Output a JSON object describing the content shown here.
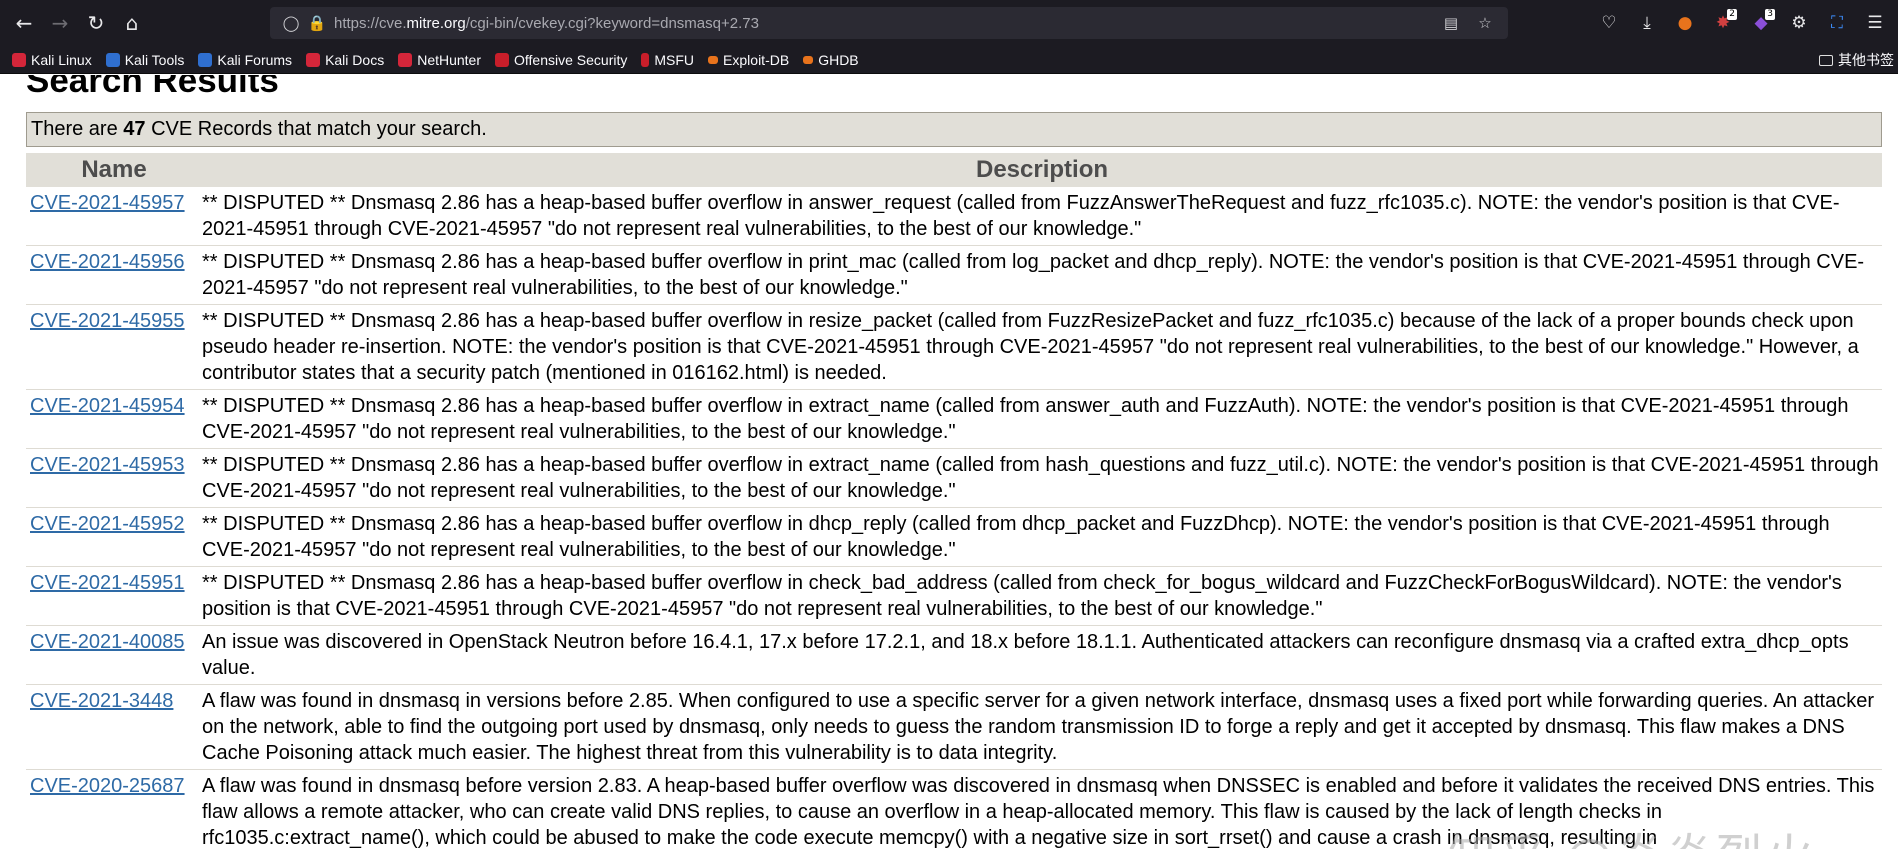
{
  "browser": {
    "url_prefix": "https://cve.",
    "url_domain": "mitre.org",
    "url_path": "/cgi-bin/cvekey.cgi?keyword=dnsmasq+2.73",
    "extension_badges": [
      "2",
      "3"
    ]
  },
  "bookmarks": [
    {
      "label": "Kali Linux",
      "color": "#d4263a"
    },
    {
      "label": "Kali Tools",
      "color": "#2f6fd0"
    },
    {
      "label": "Kali Forums",
      "color": "#2f6fd0"
    },
    {
      "label": "Kali Docs",
      "color": "#d4263a"
    },
    {
      "label": "NetHunter",
      "color": "#d4263a"
    },
    {
      "label": "Offensive Security",
      "color": "#c81e2a"
    },
    {
      "label": "MSFU",
      "color": "#c81e2a"
    },
    {
      "label": "Exploit-DB",
      "color": "#e8731c"
    },
    {
      "label": "GHDB",
      "color": "#e8731c"
    }
  ],
  "bookmarks_other": "其他书签",
  "page": {
    "heading": "Search Results",
    "match_prefix": "There are ",
    "match_count": "47",
    "match_suffix": " CVE Records that match your search.",
    "col_name": "Name",
    "col_description": "Description"
  },
  "results": [
    {
      "id": "CVE-2021-45957",
      "desc": "** DISPUTED ** Dnsmasq 2.86 has a heap-based buffer overflow in answer_request (called from FuzzAnswerTheRequest and fuzz_rfc1035.c). NOTE: the vendor's position is that CVE-2021-45951 through CVE-2021-45957 \"do not represent real vulnerabilities, to the best of our knowledge.\""
    },
    {
      "id": "CVE-2021-45956",
      "desc": "** DISPUTED ** Dnsmasq 2.86 has a heap-based buffer overflow in print_mac (called from log_packet and dhcp_reply). NOTE: the vendor's position is that CVE-2021-45951 through CVE-2021-45957 \"do not represent real vulnerabilities, to the best of our knowledge.\""
    },
    {
      "id": "CVE-2021-45955",
      "desc": "** DISPUTED ** Dnsmasq 2.86 has a heap-based buffer overflow in resize_packet (called from FuzzResizePacket and fuzz_rfc1035.c) because of the lack of a proper bounds check upon pseudo header re-insertion. NOTE: the vendor's position is that CVE-2021-45951 through CVE-2021-45957 \"do not represent real vulnerabilities, to the best of our knowledge.\" However, a contributor states that a security patch (mentioned in 016162.html) is needed."
    },
    {
      "id": "CVE-2021-45954",
      "desc": "** DISPUTED ** Dnsmasq 2.86 has a heap-based buffer overflow in extract_name (called from answer_auth and FuzzAuth). NOTE: the vendor's position is that CVE-2021-45951 through CVE-2021-45957 \"do not represent real vulnerabilities, to the best of our knowledge.\""
    },
    {
      "id": "CVE-2021-45953",
      "desc": "** DISPUTED ** Dnsmasq 2.86 has a heap-based buffer overflow in extract_name (called from hash_questions and fuzz_util.c). NOTE: the vendor's position is that CVE-2021-45951 through CVE-2021-45957 \"do not represent real vulnerabilities, to the best of our knowledge.\""
    },
    {
      "id": "CVE-2021-45952",
      "desc": "** DISPUTED ** Dnsmasq 2.86 has a heap-based buffer overflow in dhcp_reply (called from dhcp_packet and FuzzDhcp). NOTE: the vendor's position is that CVE-2021-45951 through CVE-2021-45957 \"do not represent real vulnerabilities, to the best of our knowledge.\""
    },
    {
      "id": "CVE-2021-45951",
      "desc": "** DISPUTED ** Dnsmasq 2.86 has a heap-based buffer overflow in check_bad_address (called from check_for_bogus_wildcard and FuzzCheckForBogusWildcard). NOTE: the vendor's position is that CVE-2021-45951 through CVE-2021-45957 \"do not represent real vulnerabilities, to the best of our knowledge.\""
    },
    {
      "id": "CVE-2021-40085",
      "desc": "An issue was discovered in OpenStack Neutron before 16.4.1, 17.x before 17.2.1, and 18.x before 18.1.1. Authenticated attackers can reconfigure dnsmasq via a crafted extra_dhcp_opts value."
    },
    {
      "id": "CVE-2021-3448",
      "desc": "A flaw was found in dnsmasq in versions before 2.85. When configured to use a specific server for a given network interface, dnsmasq uses a fixed port while forwarding queries. An attacker on the network, able to find the outgoing port used by dnsmasq, only needs to guess the random transmission ID to forge a reply and get it accepted by dnsmasq. This flaw makes a DNS Cache Poisoning attack much easier. The highest threat from this vulnerability is to data integrity."
    },
    {
      "id": "CVE-2020-25687",
      "desc": "A flaw was found in dnsmasq before version 2.83. A heap-based buffer overflow was discovered in dnsmasq when DNSSEC is enabled and before it validates the received DNS entries. This flaw allows a remote attacker, who can create valid DNS replies, to cause an overflow in a heap-allocated memory. This flaw is caused by the lack of length checks in rfc1035.c:extract_name(), which could be abused to make the code execute memcpy() with a negative size in sort_rrset() and cause a crash in dnsmasq, resulting in"
    }
  ],
  "watermark": "知乎 @炎炎烈火"
}
